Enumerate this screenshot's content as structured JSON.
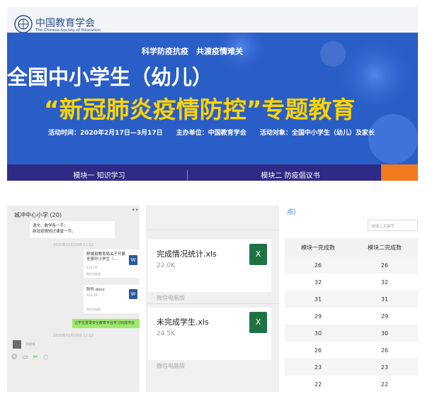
{
  "banner": {
    "org_cn": "中国教育学会",
    "org_en": "The Chinese Society of Education",
    "slogan": "科学防疫抗疫　共渡疫情难关",
    "title_line1": "全国中小学生（幼儿）",
    "title_line2": "“新冠肺炎疫情防控”专题教育",
    "info": {
      "time": "活动时间：2020年2月17日—3月17日",
      "host": "主办单位：中国教育学会",
      "target": "活动对象：全国中小学生（幼儿）及家长"
    },
    "tabs": [
      "模块一 知识学习",
      "模块二 防疫倡议书"
    ],
    "colors": {
      "hero": "#2a5ec7",
      "nav": "#2f2a85",
      "title2": "#ffd400",
      "accent": "#f27a1f"
    }
  },
  "chat": {
    "group_title": "城冲中心小学 (20)",
    "menu_icon": "•••",
    "msg1": "语文、数学各一节；\n新冠疫情知识课堂一节。",
    "timestamp1": "2020年02月20日 11:12",
    "file1": {
      "name": "舒城县教育局关于开展全县中小学生（...",
      "size": "134.5K",
      "source": "微信电脑版"
    },
    "file2": {
      "name": "附件.docx",
      "size": "102.1K",
      "source": "微信电脑版"
    },
    "green_msg": "让学生登录安全教育平台学习完成作业",
    "timestamp2": "2020年02月20日 11:12",
    "sender": "刘国强",
    "toolbar_icons": [
      "smile-icon",
      "folder-icon",
      "scissors-icon",
      "chat-icon"
    ]
  },
  "files": {
    "cards": [
      {
        "name": "完成情况统计.xls",
        "size": "22.0K",
        "source": "微信电脑版"
      },
      {
        "name": "未完成学生.xls",
        "size": "24.5K",
        "source": "微信电脑版"
      }
    ]
  },
  "table": {
    "link": "点）",
    "search_placeholder": "请输入关键字",
    "headers": [
      "模块一完成数",
      "模块二完成数"
    ],
    "rows": [
      [
        "26",
        "26"
      ],
      [
        "32",
        "32"
      ],
      [
        "31",
        "31"
      ],
      [
        "29",
        "29"
      ],
      [
        "30",
        "30"
      ],
      [
        "26",
        "26"
      ],
      [
        "23",
        "23"
      ],
      [
        "22",
        "22"
      ]
    ]
  }
}
